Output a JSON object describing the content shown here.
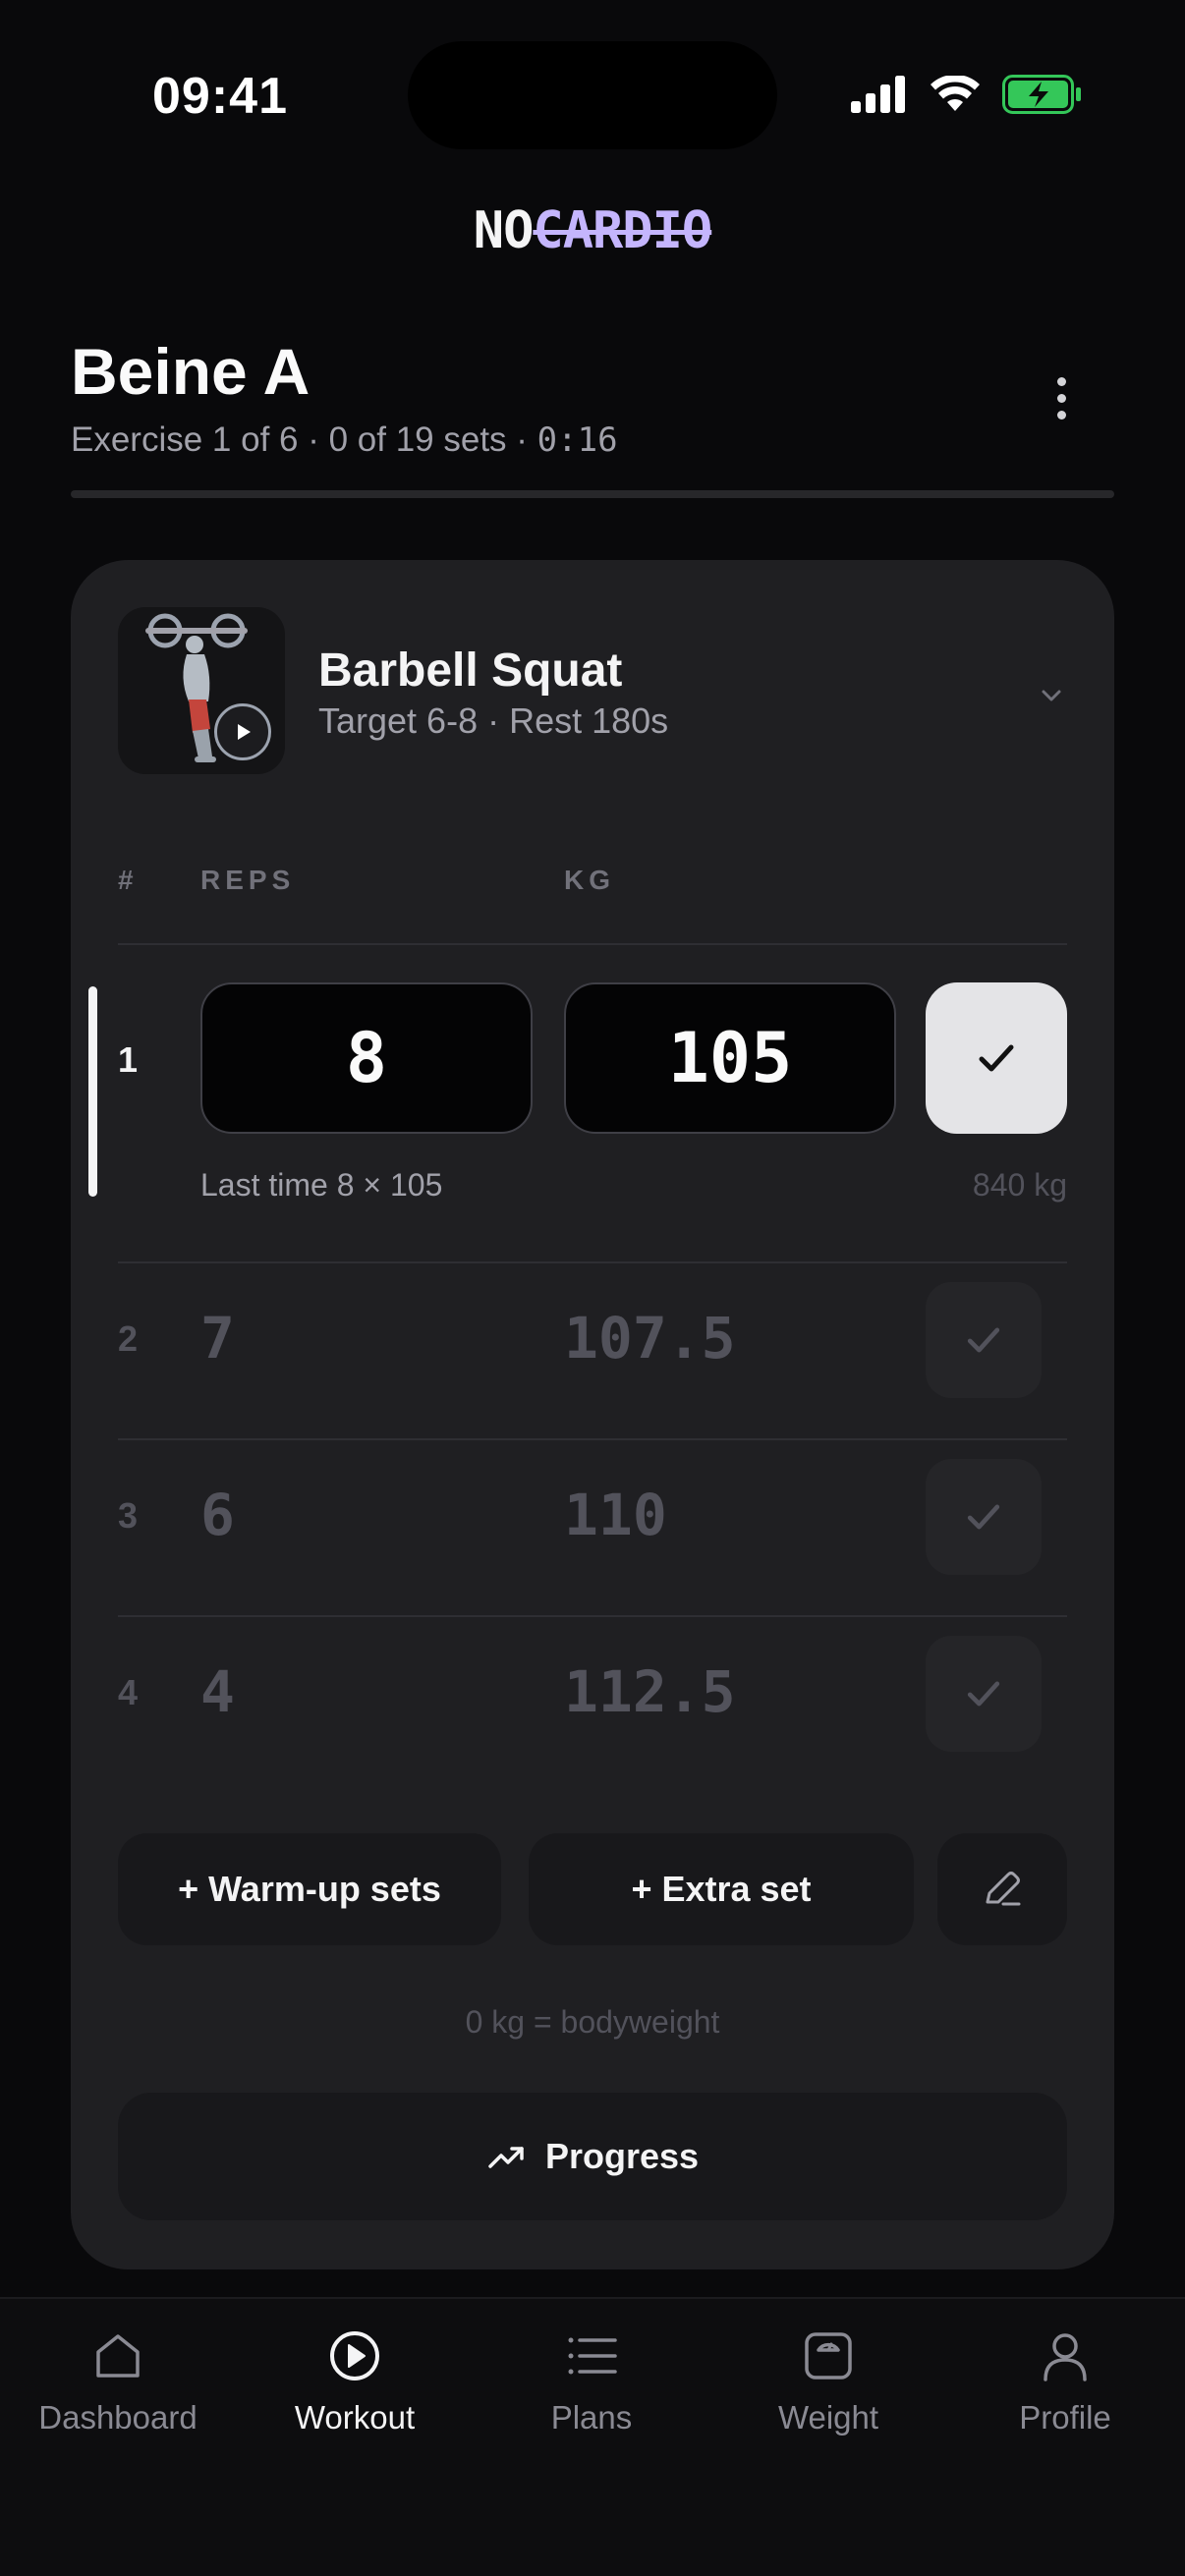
{
  "status_bar": {
    "time": "09:41"
  },
  "logo": {
    "part1": "NO",
    "part2": "CARDIO"
  },
  "workout": {
    "title": "Beine A",
    "meta_prefix": "Exercise 1 of 6 · 0 of 19 sets · ",
    "elapsed": "0:16",
    "progress": 0
  },
  "exercise": {
    "name": "Barbell Squat",
    "subtitle": "Target 6-8 · Rest 180s",
    "columns": {
      "num": "#",
      "reps": "REPS",
      "kg": "KG"
    },
    "active_set": {
      "number": "1",
      "reps": "8",
      "kg": "105",
      "last_time": "Last time 8 × 105",
      "volume": "840 kg"
    },
    "pending_sets": [
      {
        "number": "2",
        "reps": "7",
        "kg": "107.5"
      },
      {
        "number": "3",
        "reps": "6",
        "kg": "110"
      },
      {
        "number": "4",
        "reps": "4",
        "kg": "112.5"
      }
    ],
    "warmup_label": "+ Warm-up sets",
    "extra_label": "+ Extra set",
    "hint": "0 kg = bodyweight",
    "progress_label": "Progress"
  },
  "tabs": [
    {
      "label": "Dashboard",
      "icon": "home-icon"
    },
    {
      "label": "Workout",
      "icon": "play-circle-icon",
      "active": true
    },
    {
      "label": "Plans",
      "icon": "list-icon"
    },
    {
      "label": "Weight",
      "icon": "scale-icon"
    },
    {
      "label": "Profile",
      "icon": "user-icon"
    }
  ],
  "colors": {
    "accent": "#c4b5fd",
    "background": "#09090b",
    "card": "#1f1f22",
    "battery": "#34c759"
  }
}
